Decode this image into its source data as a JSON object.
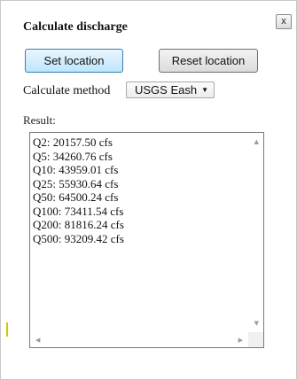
{
  "dialog": {
    "title": "Calculate discharge",
    "close_label": "x"
  },
  "buttons": {
    "set_location": "Set location",
    "reset_location": "Reset location"
  },
  "method": {
    "label": "Calculate method",
    "selected": "USGS Eash"
  },
  "result": {
    "label": "Result:",
    "lines": [
      "Q2: 20157.50 cfs",
      "Q5: 34260.76 cfs",
      "Q10: 43959.01 cfs",
      "Q25: 55930.64 cfs",
      "Q50: 64500.24 cfs",
      "Q100: 73411.54 cfs",
      "Q200: 81816.24 cfs",
      "Q500: 93209.42 cfs"
    ]
  },
  "icons": {
    "scroll_up": "scroll-up-arrow-icon",
    "scroll_down": "scroll-down-arrow-icon",
    "scroll_left": "scroll-left-arrow-icon",
    "scroll_right": "scroll-right-arrow-icon",
    "dropdown": "chevron-down-icon"
  },
  "colors": {
    "primary_button": "#bee6fd",
    "primary_button_border": "#3c7fb1"
  }
}
